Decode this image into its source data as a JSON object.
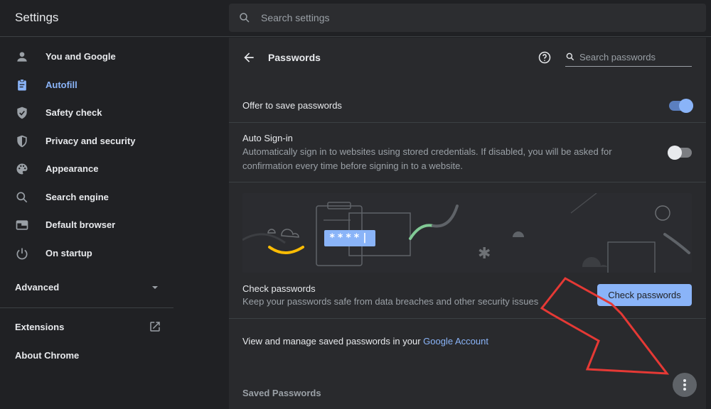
{
  "header": {
    "title": "Settings",
    "search_placeholder": "Search settings"
  },
  "sidebar": {
    "items": [
      {
        "label": "You and Google",
        "icon": "person-icon"
      },
      {
        "label": "Autofill",
        "icon": "clipboard-icon",
        "active": true
      },
      {
        "label": "Safety check",
        "icon": "shield-check-icon"
      },
      {
        "label": "Privacy and security",
        "icon": "shield-icon"
      },
      {
        "label": "Appearance",
        "icon": "palette-icon"
      },
      {
        "label": "Search engine",
        "icon": "search-icon"
      },
      {
        "label": "Default browser",
        "icon": "browser-window-icon"
      },
      {
        "label": "On startup",
        "icon": "power-icon"
      }
    ],
    "advanced_label": "Advanced",
    "extensions_label": "Extensions",
    "about_label": "About Chrome"
  },
  "passwords": {
    "title": "Passwords",
    "search_placeholder": "Search passwords",
    "offer_to_save_label": "Offer to save passwords",
    "offer_to_save_enabled": true,
    "auto_signin_label": "Auto Sign-in",
    "auto_signin_desc": "Automatically sign in to websites using stored credentials. If disabled, you will be asked for confirmation every time before signing in to a website.",
    "auto_signin_enabled": false,
    "illustration_text": "****|",
    "check_title": "Check passwords",
    "check_desc": "Keep your passwords safe from data breaches and other security issues",
    "check_button": "Check passwords",
    "manage_prefix": "View and manage saved passwords in your ",
    "manage_link": "Google Account",
    "saved_passwords_label": "Saved Passwords"
  },
  "colors": {
    "accent": "#8ab4f8",
    "background": "#202124",
    "card": "#292a2d",
    "annotation_arrow": "#e53935"
  }
}
